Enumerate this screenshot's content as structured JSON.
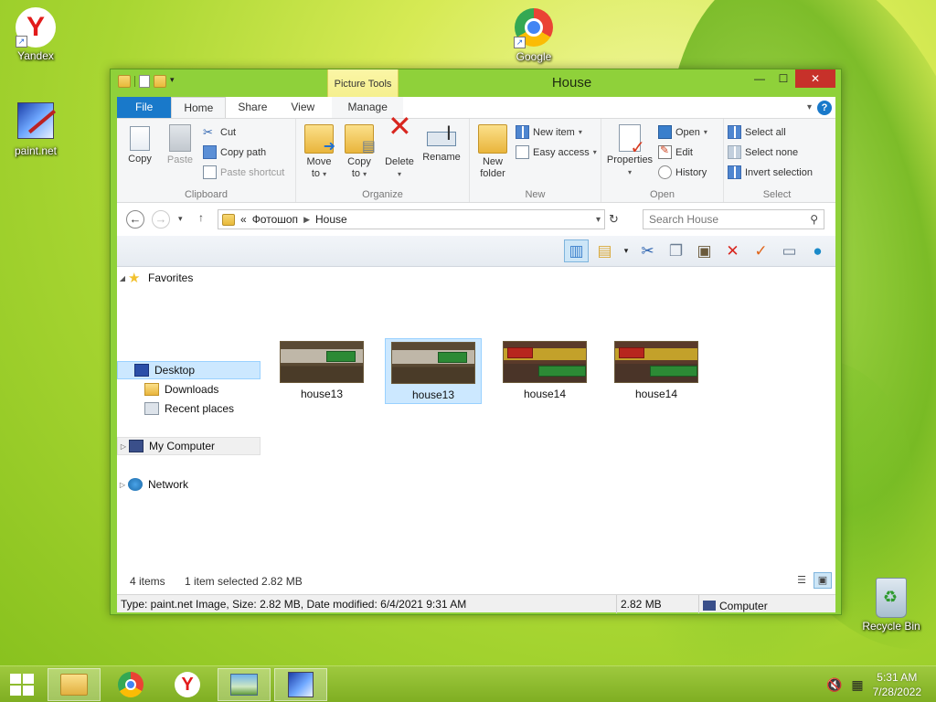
{
  "desktop": {
    "icons": [
      {
        "label": "Yandex",
        "icon": "yandex-icon"
      },
      {
        "label": "Google",
        "icon": "chrome-icon"
      },
      {
        "label": "paint.net",
        "icon": "paintnet-icon"
      },
      {
        "label": "Recycle Bin",
        "icon": "recycle-bin-icon"
      }
    ]
  },
  "window": {
    "title": "House",
    "context_tab_group": "Picture Tools",
    "tabs": [
      {
        "label": "File"
      },
      {
        "label": "Home"
      },
      {
        "label": "Share"
      },
      {
        "label": "View"
      },
      {
        "label": "Manage"
      }
    ],
    "controls": {
      "minimize": "—",
      "maximize": "☐",
      "close": "✕",
      "help": "?"
    }
  },
  "ribbon": {
    "clipboard": {
      "label": "Clipboard",
      "copy": "Copy",
      "paste": "Paste",
      "cut": "Cut",
      "copy_path": "Copy path",
      "paste_shortcut": "Paste shortcut"
    },
    "organize": {
      "label": "Organize",
      "move_to_1": "Move",
      "move_to_2": "to",
      "copy_to_1": "Copy",
      "copy_to_2": "to",
      "delete": "Delete",
      "rename": "Rename"
    },
    "new": {
      "label": "New",
      "new_folder_1": "New",
      "new_folder_2": "folder",
      "new_item": "New item",
      "easy_access": "Easy access"
    },
    "open": {
      "label": "Open",
      "properties": "Properties",
      "open": "Open",
      "edit": "Edit",
      "history": "History"
    },
    "select": {
      "label": "Select",
      "select_all": "Select all",
      "select_none": "Select none",
      "invert_selection": "Invert selection"
    }
  },
  "address": {
    "prefix": "«",
    "segments": [
      "Фотошоп",
      "House"
    ],
    "search_placeholder": "Search House"
  },
  "nav_pane": {
    "favorites": "Favorites",
    "desktop": "Desktop",
    "downloads": "Downloads",
    "recent_places": "Recent places",
    "my_computer": "My Computer",
    "network": "Network"
  },
  "files": [
    {
      "name": "house13",
      "selected": false
    },
    {
      "name": "house13",
      "selected": true
    },
    {
      "name": "house14",
      "selected": false
    },
    {
      "name": "house14",
      "selected": false
    }
  ],
  "status": {
    "item_count": "4 items",
    "selection": "1 item selected  2.82 MB"
  },
  "details": {
    "info": "Type: paint.net Image, Size: 2.82 MB, Date modified: 6/4/2021 9:31 AM",
    "size": "2.82 MB",
    "location": "Computer"
  },
  "taskbar": {
    "time": "5:31 AM",
    "date": "7/28/2022"
  }
}
